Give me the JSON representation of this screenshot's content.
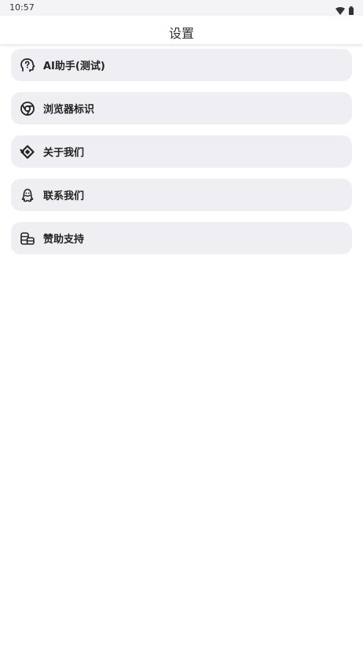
{
  "status_bar": {
    "time": "10:57",
    "wifi_icon": "wifi-icon",
    "battery_icon": "battery-icon"
  },
  "app_bar": {
    "title": "设置"
  },
  "menu": {
    "items": [
      {
        "label": "AI助手(测试)",
        "icon": "ai-help-icon"
      },
      {
        "label": "浏览器标识",
        "icon": "browser-icon"
      },
      {
        "label": "关于我们",
        "icon": "about-icon"
      },
      {
        "label": "联系我们",
        "icon": "qq-icon"
      },
      {
        "label": "赞助支持",
        "icon": "coins-icon"
      }
    ]
  },
  "colors": {
    "item_background": "#efeef3",
    "page_background": "#ffffff",
    "status_bar_background": "#f4f4f6",
    "text": "#222222"
  }
}
